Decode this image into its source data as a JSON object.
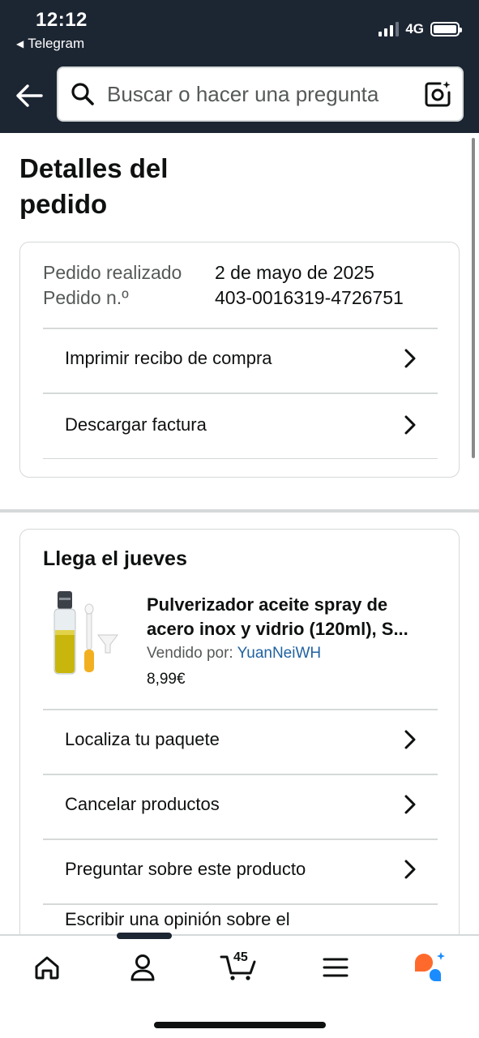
{
  "status_bar": {
    "time": "12:12",
    "back_app": "Telegram",
    "network": "4G"
  },
  "search": {
    "placeholder": "Buscar o hacer una pregunta"
  },
  "page_title": "Detalles del pedido",
  "order_info": {
    "placed_label": "Pedido realizado",
    "placed_value": "2 de mayo de 2025",
    "number_label": "Pedido n.º",
    "number_value": "403-0016319-4726751",
    "actions": [
      {
        "label": "Imprimir recibo de compra"
      },
      {
        "label": "Descargar factura"
      }
    ]
  },
  "shipment": {
    "heading": "Llega el jueves",
    "product": {
      "title": "Pulverizador aceite spray de acero inox y vidrio (120ml), S...",
      "seller_label": "Vendido por:",
      "seller_name": "YuanNeiWH",
      "price": "8,99€"
    },
    "actions": [
      {
        "label": "Localiza tu paquete"
      },
      {
        "label": "Cancelar productos"
      },
      {
        "label": "Preguntar sobre este producto"
      },
      {
        "label": "Escribir una opinión sobre el"
      }
    ]
  },
  "bottom_nav": {
    "cart_count": "45",
    "items": [
      "home-icon",
      "account-icon",
      "cart-icon",
      "menu-icon",
      "rufus-ai-icon"
    ]
  },
  "colors": {
    "header_bg": "#1c2532",
    "link_blue": "#2162a1",
    "divider": "#d5d9d9",
    "accent_orange": "#ff6a2c",
    "accent_blue": "#1a8cff"
  }
}
